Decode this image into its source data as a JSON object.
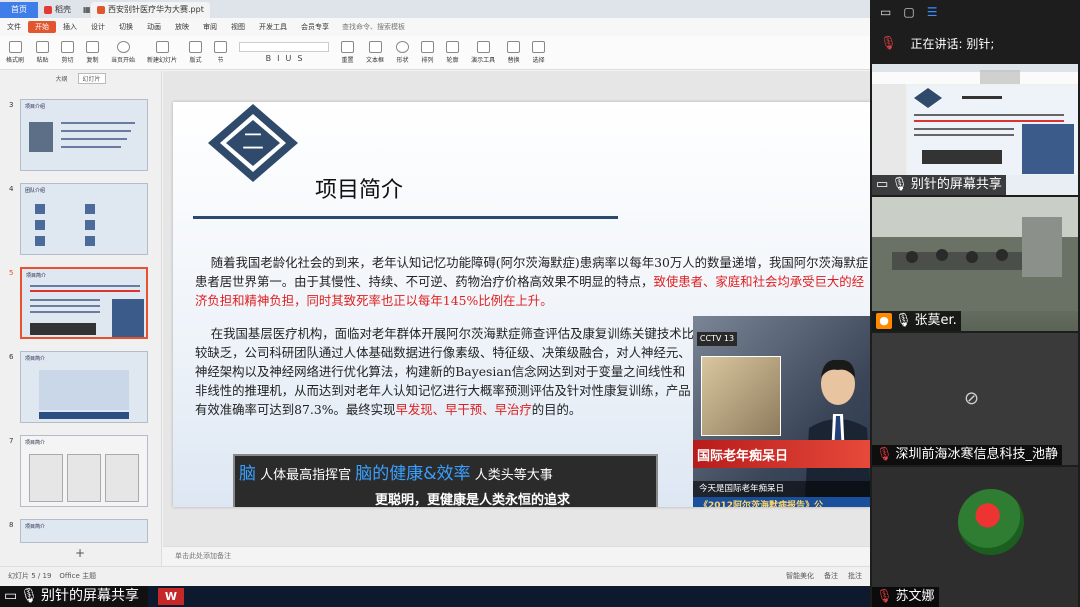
{
  "wps": {
    "home_tab": "首页",
    "tabs": [
      {
        "label": "稻壳"
      },
      {
        "label": "西安别针医疗华为大赛.ppt"
      }
    ],
    "menu": [
      "文件",
      "开始",
      "插入",
      "设计",
      "切换",
      "动画",
      "放映",
      "审阅",
      "视图",
      "开发工具",
      "会员专享"
    ],
    "search_placeholder": "查找命令、搜索模板",
    "ribbon": [
      "格式刷",
      "粘贴",
      "剪切",
      "复制",
      "当页开始",
      "新建幻灯片",
      "版式",
      "节",
      "重置",
      "文本框",
      "形状",
      "排列",
      "轮廓",
      "演示工具",
      "替换",
      "选择"
    ],
    "view_tabs": [
      "大纲",
      "幻灯片"
    ],
    "thumbnails": [
      {
        "num": "3",
        "title": "项目介绍"
      },
      {
        "num": "4",
        "title": "团队介绍"
      },
      {
        "num": "5",
        "title": "项目简介"
      },
      {
        "num": "6",
        "title": "项目简介"
      },
      {
        "num": "7",
        "title": "项目简介"
      },
      {
        "num": "8",
        "title": "项目简介"
      }
    ],
    "notes_placeholder": "单击此处添加备注",
    "status": {
      "slide": "幻灯片 5 / 19",
      "theme": "Office 主题",
      "right": [
        "智能美化",
        "备注",
        "批注"
      ]
    }
  },
  "slide": {
    "number_glyph": "二",
    "title": "项目简介",
    "para1_plain": "随着我国老龄化社会的到来，老年认知记忆功能障碍(阿尔茨海默症)患病率以每年30万人的数量递增，我国阿尔茨海默症患者居世界第一。由于其慢性、持续、不可逆、药物治疗价格高效果不明显的特点，",
    "para1_red": "致使患者、家庭和社会均承受巨大的经济负担和精神负担，同时其致死率也正以每年145%比例在上升。",
    "para2_plain": "在我国基层医疗机构，面临对老年群体开展阿尔茨海默症筛查评估及康复训练关键技术比较缺乏，公司科研团队通过人体基础数据进行像素级、特征级、决策级融合，对人神经元、神经架构以及神经网络进行优化算法，构建新的Bayesian信念网达到对于变量之间线性和非线性的推理机，从而达到对老年人认知记忆进行大概率预测评估及针对性康复训练，产品有效准确率可达到87.3%。最终实现",
    "para2_red1": "早发现",
    "para2_sep1": "、",
    "para2_red2": "早干预",
    "para2_sep2": "、",
    "para2_red3": "早治疗",
    "para2_end": "的目的。",
    "banner": {
      "brain1": "脑",
      "text1": "人体最高指挥官",
      "brain2": "脑的健康&效率",
      "text2": "人类头等大事",
      "line2": "更聪明，更健康是人类永恒的追求"
    },
    "cctv": {
      "logo": "CCTV 13",
      "band": "国际老年痴呆日",
      "caption1": "今天是国际老年痴呆日",
      "caption2": "《2012阿尔茨海默病报告》公"
    }
  },
  "share_overlay": "别针的屏幕共享",
  "meeting": {
    "speaking": "正在讲话: 别针;",
    "participants": [
      {
        "name": "别针的屏幕共享"
      },
      {
        "name": "张莫er."
      },
      {
        "name": "深圳前海冰寒信息科技_池静"
      },
      {
        "name": "苏文娜"
      }
    ]
  }
}
